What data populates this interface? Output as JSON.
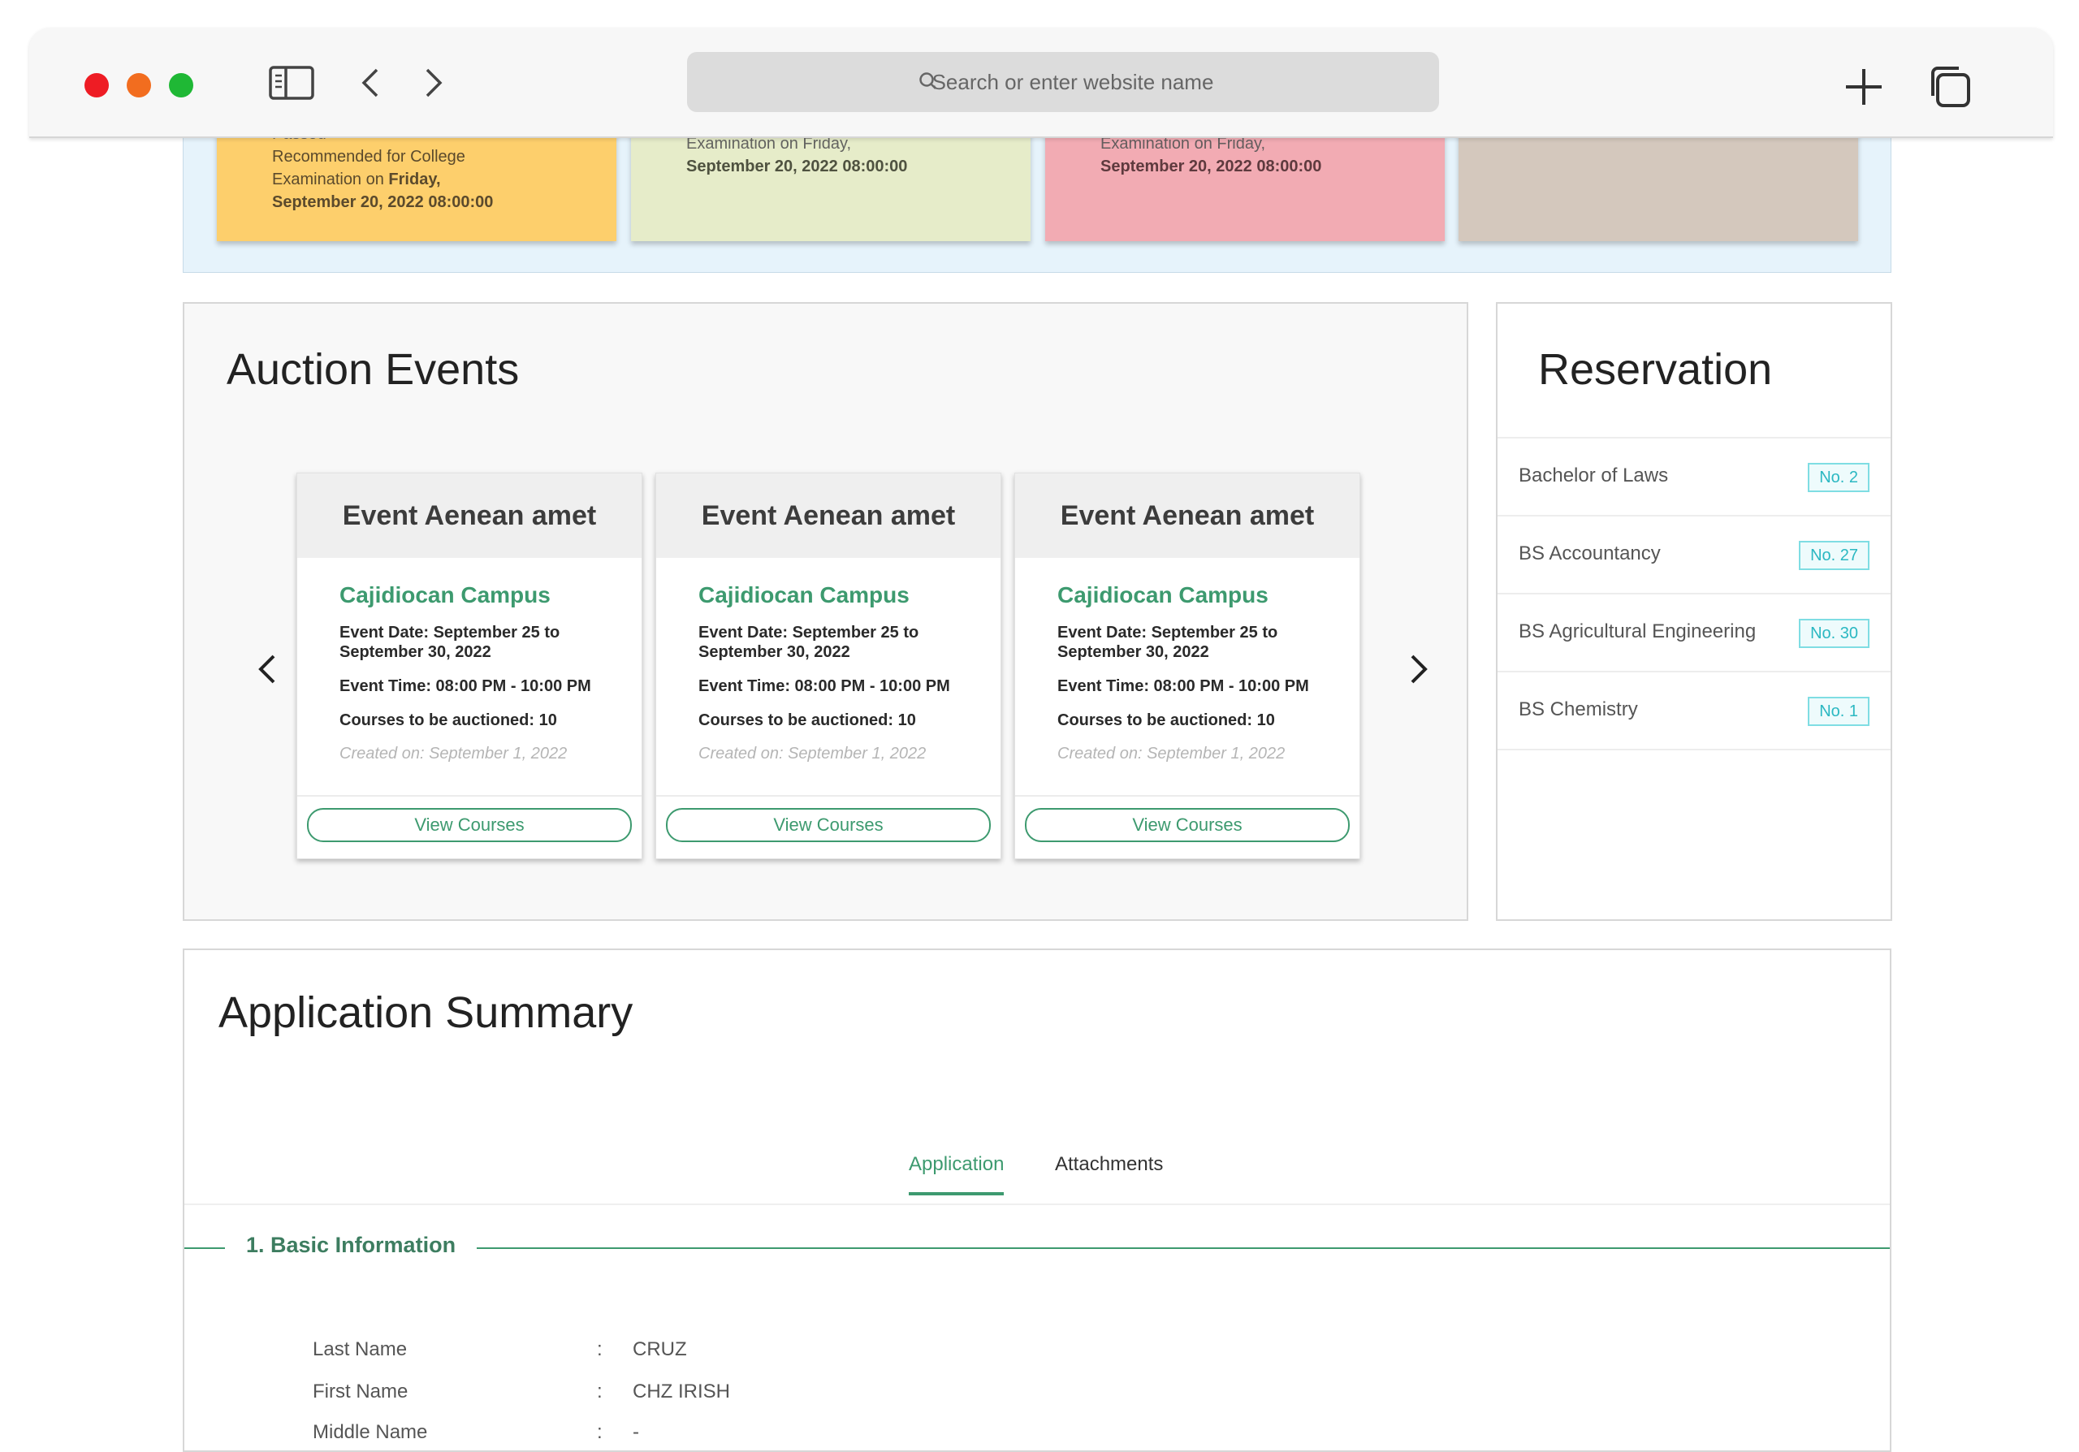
{
  "browser": {
    "address_placeholder": "Search or enter website name",
    "icons": [
      "sidebar-icon",
      "back-icon",
      "forward-icon",
      "search-icon",
      "new-tab-icon",
      "tabs-overview-icon"
    ]
  },
  "sticky_notes": [
    {
      "color": "#fdcf6c",
      "partial_top": "Passed",
      "line1": "Recommended for College",
      "line2_prefix": "Examination on ",
      "line2_bold": "Friday,",
      "line3": "September 20, 2022 08:00:00"
    },
    {
      "color": "#e6ecc9",
      "partial_top": "Examination on Friday,",
      "line3": "September 20, 2022 08:00:00"
    },
    {
      "color": "#f2abb3",
      "partial_top": "Examination on Friday,",
      "line3": "September 20, 2022 08:00:00"
    },
    {
      "color": "#d4c8bd"
    }
  ],
  "auction": {
    "title": "Auction Events",
    "events": [
      {
        "title": "Event Aenean amet",
        "campus": "Cajidiocan Campus",
        "date": "Event Date: September 25 to September 30, 2022",
        "time": "Event Time: 08:00 PM - 10:00 PM",
        "courses": "Courses to be auctioned: 10",
        "created": "Created on: September 1, 2022",
        "button": "View Courses"
      },
      {
        "title": "Event Aenean amet",
        "campus": "Cajidiocan Campus",
        "date": "Event Date: September 25 to September 30, 2022",
        "time": "Event Time: 08:00 PM - 10:00 PM",
        "courses": "Courses to be auctioned: 10",
        "created": "Created on: September 1, 2022",
        "button": "View Courses"
      },
      {
        "title": "Event Aenean amet",
        "campus": "Cajidiocan Campus",
        "date": "Event Date: September 25 to September 30, 2022",
        "time": "Event Time: 08:00 PM - 10:00 PM",
        "courses": "Courses to be auctioned: 10",
        "created": "Created on: September 1, 2022",
        "button": "View Courses"
      }
    ]
  },
  "reservation": {
    "title": "Reservation",
    "items": [
      {
        "label": "Bachelor of Laws",
        "badge": "No. 2"
      },
      {
        "label": "BS Accountancy",
        "badge": "No. 27"
      },
      {
        "label": "BS Agricultural Engineering",
        "badge": "No. 30"
      },
      {
        "label": "BS Chemistry",
        "badge": "No. 1"
      }
    ]
  },
  "summary": {
    "title": "Application Summary",
    "tabs": [
      {
        "label": "Application",
        "active": true
      },
      {
        "label": "Attachments",
        "active": false
      }
    ],
    "section_title": "1. Basic Information",
    "fields": [
      {
        "label": "Last Name",
        "value": "CRUZ"
      },
      {
        "label": "First Name",
        "value": "CHZ IRISH"
      },
      {
        "label": "Middle Name",
        "value": "-"
      }
    ]
  },
  "colors": {
    "accent": "#3d9a6f",
    "badge": "#2bb8c2",
    "top_panel_bg": "#e6f3fb"
  }
}
